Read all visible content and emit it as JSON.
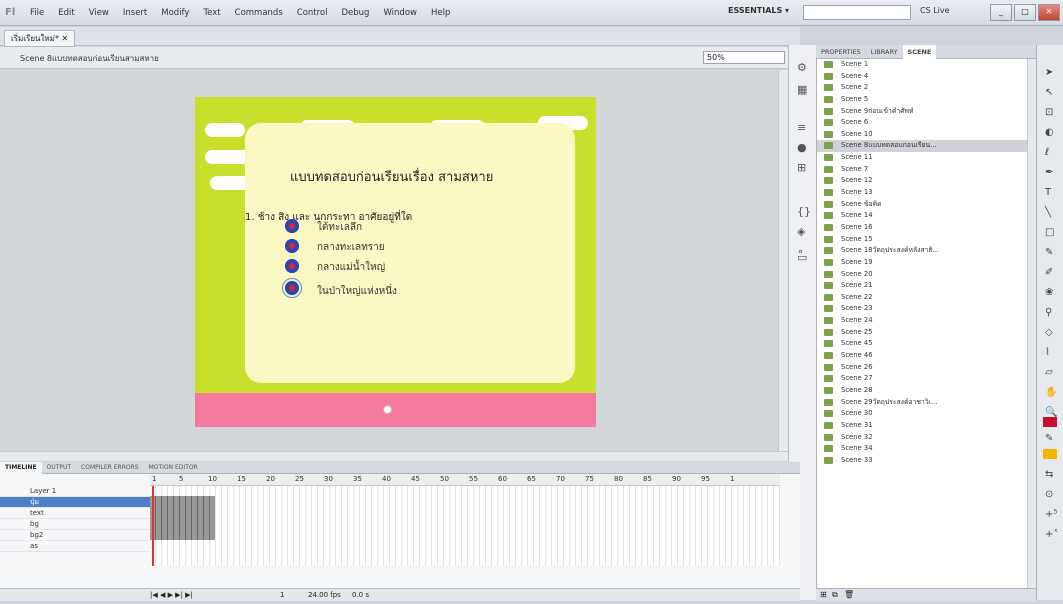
{
  "app": {
    "menu": [
      "File",
      "Edit",
      "View",
      "Insert",
      "Modify",
      "Text",
      "Commands",
      "Control",
      "Debug",
      "Window",
      "Help"
    ],
    "workspace": "ESSENTIALS ▾",
    "cslive": "CS Live",
    "logo": "Fl"
  },
  "doc": {
    "tab": "เริ่มเรียนใหม่* ✕",
    "scene_label": "Scene 8แบบทดสอบก่อนเรียนสามสหาย",
    "zoom": "50%"
  },
  "stage": {
    "title": "แบบทดสอบก่อนเรียนเรื่อง  สามสหาย",
    "question": "1. ช้าง สิง และ นกกระทา อาศัยอยู่ที่ใด",
    "options": [
      "ใต้ทะเลลึก",
      "กลางทะเลทราย",
      "กลางแม่น้ำใหญ่",
      "ในป่าใหญ่แห่งหนึ่ง"
    ]
  },
  "panel": {
    "tabs": [
      "PROPERTIES",
      "LIBRARY",
      "SCENE"
    ],
    "scenes": [
      "Scene 1",
      "Scene 4",
      "Scene 2",
      "Scene 5",
      "Scene 9ก่อนเข้าคำศัพท์",
      "Scene 6",
      "Scene 10",
      "Scene 8แบบทดสอบก่อนเรียน...",
      "Scene 11",
      "Scene 7",
      "Scene 12",
      "Scene 13",
      "Scene ข้อคิด",
      "Scene 14",
      "Scene 16",
      "Scene 15",
      "Scene 18วัตถุประสงค์หลังสาธิ...",
      "Scene 19",
      "Scene 20",
      "Scene 21",
      "Scene 22",
      "Scene 23",
      "Scene 24",
      "Scene 25",
      "Scene 45",
      "Scene 46",
      "Scene 26",
      "Scene 27",
      "Scene 28",
      "Scene 29วัตถุประสงค์อาชาวิเ...",
      "Scene 30",
      "Scene 31",
      "Scene 32",
      "Scene 34",
      "Scene 33"
    ]
  },
  "timeline": {
    "tabs": [
      "TIMELINE",
      "OUTPUT",
      "COMPILER ERRORS",
      "MOTION EDITOR"
    ],
    "ruler": [
      "1",
      "5",
      "10",
      "15",
      "20",
      "25",
      "30",
      "35",
      "40",
      "45",
      "50",
      "55",
      "60",
      "65",
      "70",
      "75",
      "80",
      "85",
      "90",
      "95",
      "1"
    ],
    "layers": [
      "Layer 1",
      "ปุ่ม",
      "text",
      "bg",
      "bg2",
      "as"
    ],
    "fps": "24.00 fps",
    "time": "0.0 s",
    "frame": "1"
  }
}
